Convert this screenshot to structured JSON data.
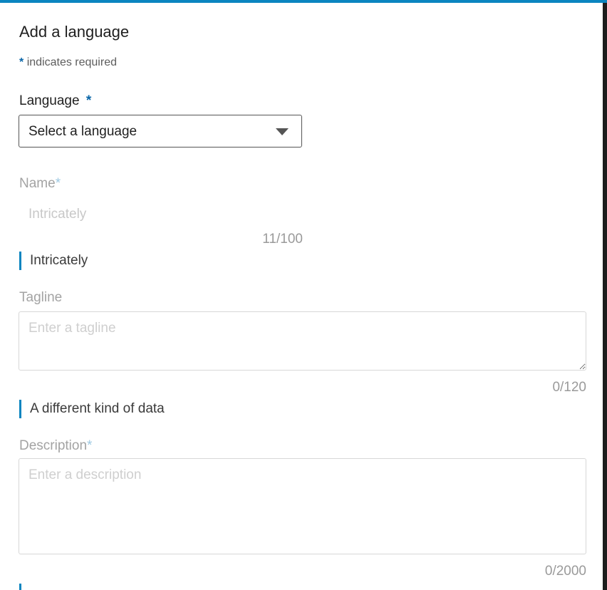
{
  "dialog": {
    "title": "Add a language",
    "required_star": "*",
    "required_note": "indicates required"
  },
  "language_field": {
    "label": "Language",
    "star": "*",
    "selected_value": "Select a language"
  },
  "name_field": {
    "label": "Name",
    "star": "*",
    "value": "Intricately",
    "counter": "11/100",
    "preview": "Intricately"
  },
  "tagline_field": {
    "label": "Tagline",
    "placeholder": "Enter a tagline",
    "counter": "0/120",
    "preview": "A different kind of data"
  },
  "description_field": {
    "label": "Description",
    "star": "*",
    "placeholder": "Enter a description",
    "counter": "0/2000"
  },
  "colors": {
    "accent": "#0a85c0",
    "required_star": "#0a66a8"
  },
  "icons": {
    "select_caret": "caret-down-icon"
  }
}
